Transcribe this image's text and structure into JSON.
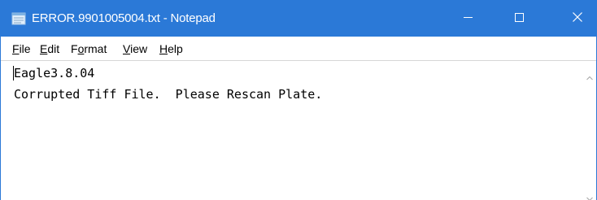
{
  "window": {
    "title": "ERROR.9901005004.txt - Notepad",
    "app_icon": "notepad-icon",
    "titlebar_color": "#2b79d7",
    "controls": {
      "minimize_icon": "minimize-icon",
      "maximize_icon": "maximize-icon",
      "close_icon": "close-icon"
    }
  },
  "menu": {
    "items": [
      {
        "accel": "F",
        "rest": "ile"
      },
      {
        "accel": "E",
        "rest": "dit"
      },
      {
        "pre": "F",
        "accel": "o",
        "rest": "rmat"
      },
      {
        "accel": "V",
        "rest": "iew"
      },
      {
        "accel": "H",
        "rest": "elp"
      }
    ]
  },
  "document": {
    "lines": [
      "Eagle3.8.04",
      "Corrupted Tiff File.  Please Rescan Plate."
    ]
  },
  "scrollbar": {
    "up_icon": "scroll-up-arrow-icon",
    "down_icon": "scroll-down-arrow-icon"
  }
}
